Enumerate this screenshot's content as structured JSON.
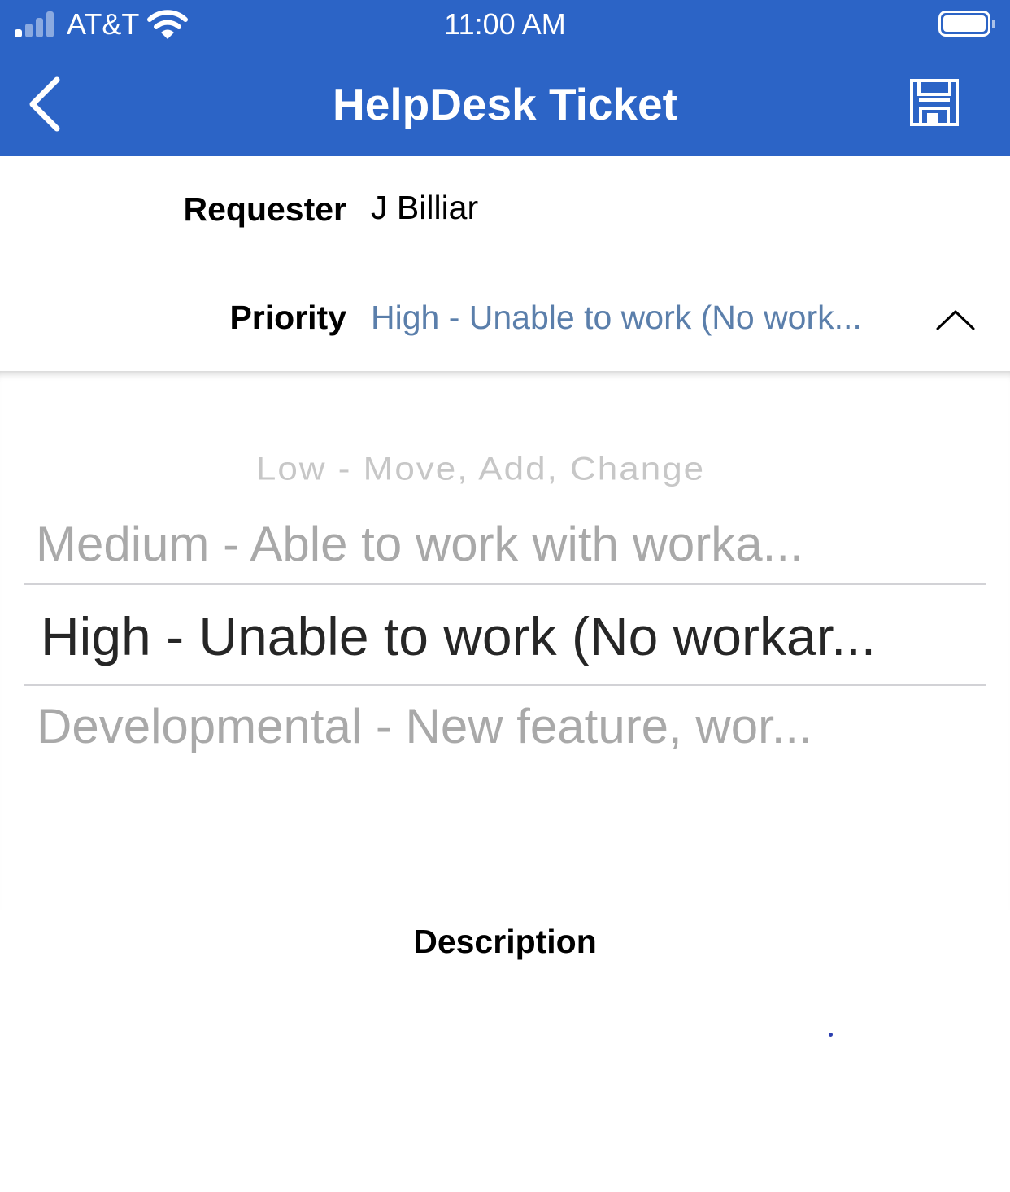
{
  "status_bar": {
    "carrier": "AT&T",
    "time": "11:00 AM",
    "signal_bars": 4,
    "signal_active_bars": 1
  },
  "header": {
    "title": "HelpDesk Ticket",
    "back_icon": "chevron-left-icon",
    "save_icon": "floppy-disk-icon",
    "background_color": "#2c64c6"
  },
  "form": {
    "requester": {
      "label": "Requester",
      "value": "J Billiar"
    },
    "priority": {
      "label": "Priority",
      "value": "High - Unable to work (No work...",
      "toggle_icon": "chevron-up-icon"
    },
    "description": {
      "label": "Description"
    }
  },
  "priority_picker": {
    "options": [
      "Low - Move, Add, Change",
      "Medium - Able to work with worka...",
      "High - Unable to work (No workar...",
      "Developmental - New feature, wor..."
    ],
    "selected_index": 2
  }
}
